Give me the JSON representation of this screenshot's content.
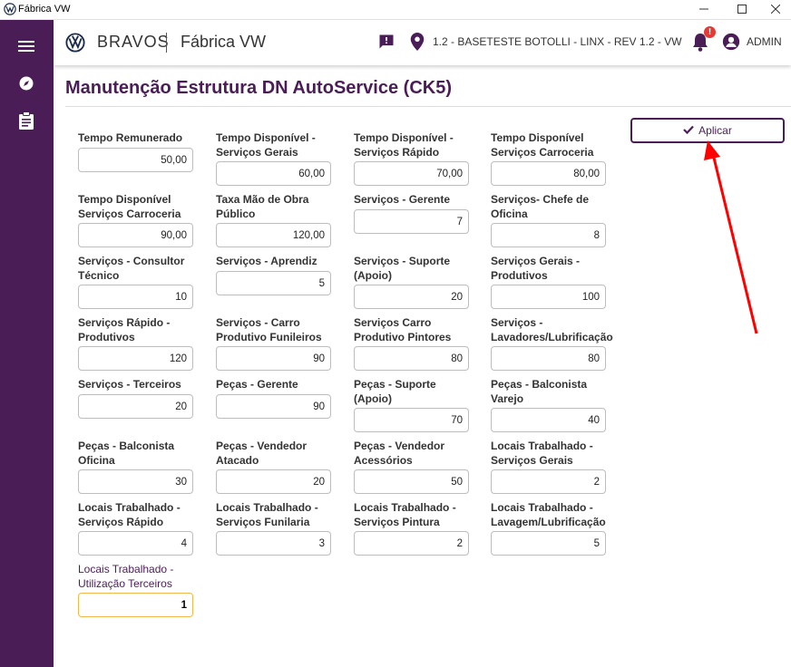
{
  "window": {
    "title": "Fábrica VW"
  },
  "header": {
    "brand": "BRAVOS",
    "app_name": "Fábrica VW",
    "location": "1.2 - BASETESTE BOTOLLI - LINX - REV 1.2 - VW",
    "notification_count": "!",
    "user": "ADMIN"
  },
  "sidebar": {
    "icons": [
      "menu-icon",
      "compass-icon",
      "clipboard-icon"
    ]
  },
  "page": {
    "title": "Manutenção Estrutura DN AutoService (CK5)"
  },
  "actions": {
    "apply_label": "Aplicar"
  },
  "colors": {
    "sidebar": "#4a1d57",
    "accent": "#4a1d57",
    "focus_border": "#f2b84b",
    "annotation_arrow": "#ff0000"
  },
  "fields": [
    {
      "label": "Tempo Remunerado",
      "value": "50,00"
    },
    {
      "label": "Tempo Disponível -\nServiços Gerais",
      "value": "60,00"
    },
    {
      "label": "Tempo Disponível -\nServiços Rápido",
      "value": "70,00"
    },
    {
      "label": "Tempo Disponível\nServiços Carroceria",
      "value": "80,00"
    },
    {
      "label": "Tempo Disponível\nServiços Carroceria",
      "value": "90,00"
    },
    {
      "label": "Taxa Mão de Obra\nPúblico",
      "value": "120,00"
    },
    {
      "label": "Serviços - Gerente",
      "value": "7"
    },
    {
      "label": "Serviços- Chefe de\nOficina",
      "value": "8"
    },
    {
      "label": "Serviços - Consultor\nTécnico",
      "value": "10"
    },
    {
      "label": "Serviços - Aprendiz",
      "value": "5"
    },
    {
      "label": "Serviços - Suporte\n(Apoio)",
      "value": "20"
    },
    {
      "label": "Serviços Gerais -\nProdutivos",
      "value": "100"
    },
    {
      "label": "Serviços Rápido -\nProdutivos",
      "value": "120"
    },
    {
      "label": "Serviços - Carro\nProdutivo Funileiros",
      "value": "90"
    },
    {
      "label": "Serviços Carro\nProdutivo Pintores",
      "value": "80"
    },
    {
      "label": "Serviços -\nLavadores/Lubrificação",
      "value": "80"
    },
    {
      "label": "Serviços - Terceiros",
      "value": "20"
    },
    {
      "label": "Peças - Gerente",
      "value": "90"
    },
    {
      "label": "Peças - Suporte\n(Apoio)",
      "value": "70"
    },
    {
      "label": "Peças - Balconista\nVarejo",
      "value": "40"
    },
    {
      "label": "Peças - Balconista\nOficina",
      "value": "30"
    },
    {
      "label": "Peças - Vendedor\nAtacado",
      "value": "20"
    },
    {
      "label": "Peças - Vendedor\nAcessórios",
      "value": "50"
    },
    {
      "label": "Locais Trabalhado -\nServiços Gerais",
      "value": "2"
    },
    {
      "label": "Locais Trabalhado -\nServiços Rápido",
      "value": "4"
    },
    {
      "label": "Locais Trabalhado -\nServiços Funilaria",
      "value": "3"
    },
    {
      "label": "Locais Trabalhado -\nServiços Pintura",
      "value": "2"
    },
    {
      "label": "Locais Trabalhado -\nLavagem/Lubrificação",
      "value": "5"
    },
    {
      "label": "Locais Trabalhado -\nUtilização Terceiros",
      "value": "1"
    }
  ]
}
